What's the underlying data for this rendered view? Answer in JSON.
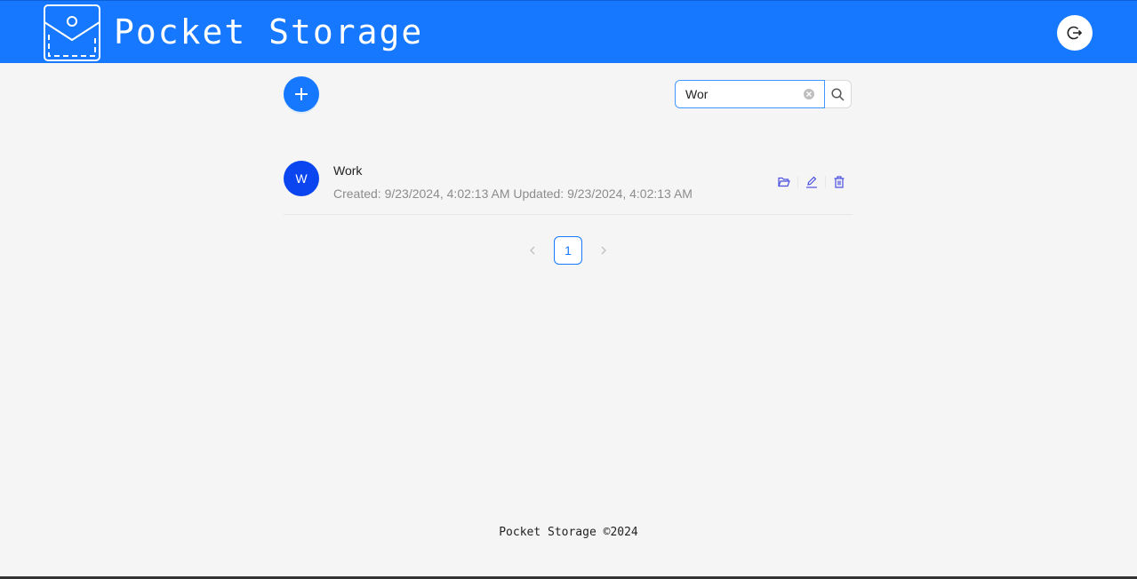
{
  "header": {
    "app_title": "Pocket Storage",
    "logo_icon": "pocket-icon",
    "logout_icon": "logout-icon",
    "brand_color": "#1677ff"
  },
  "toolbar": {
    "add_icon": "plus-icon",
    "search": {
      "value": "Wor",
      "placeholder": "",
      "clear_icon": "close-circle-icon",
      "button_icon": "search-icon"
    }
  },
  "list": {
    "items": [
      {
        "avatar_letter": "W",
        "title": "Work",
        "description": "Created: 9/23/2024, 4:02:13 AM Updated: 9/23/2024, 4:02:13 AM",
        "avatar_color": "#0a45f0",
        "actions": [
          "folder-open-icon",
          "edit-icon",
          "delete-icon"
        ]
      }
    ]
  },
  "pagination": {
    "current_page": "1",
    "prev_icon": "chevron-left-icon",
    "next_icon": "chevron-right-icon"
  },
  "footer": {
    "text": "Pocket Storage ©2024"
  }
}
